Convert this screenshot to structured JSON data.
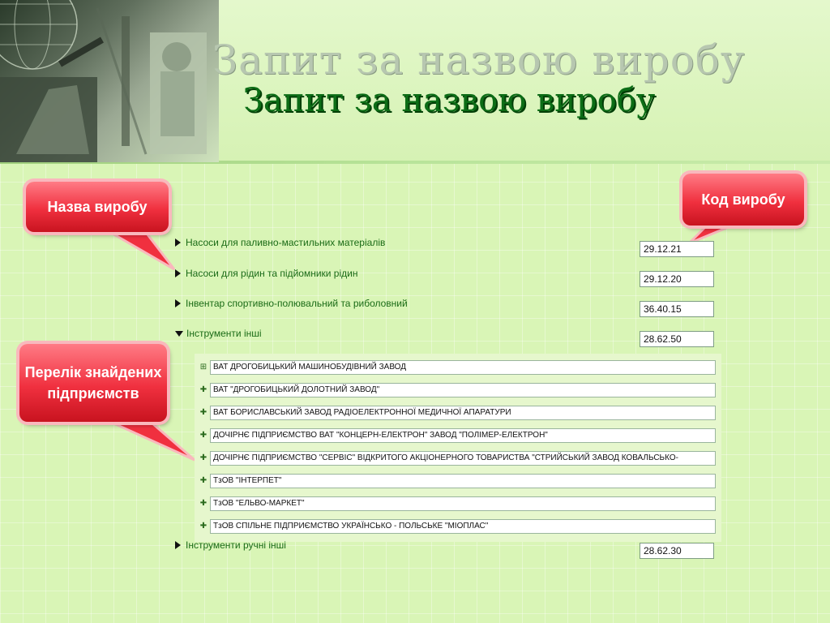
{
  "page": {
    "title": "Запит за назвою виробу"
  },
  "callouts": {
    "product_name": "Назва виробу",
    "product_code": "Код виробу",
    "enterprise_list": "Перелік знайдених підприємств"
  },
  "tree": [
    {
      "label": "Насоси для  паливно-мастильних  матеріалів",
      "code": "29.12.21",
      "expanded": false
    },
    {
      "label": "Насоси для рідин та підйомники рідин",
      "code": "29.12.20",
      "expanded": false
    },
    {
      "label": "Інвентар спортивно-полювальний та риболовний",
      "code": "36.40.15",
      "expanded": false
    },
    {
      "label": "Інструменти інші",
      "code": "28.62.50",
      "expanded": true
    },
    {
      "label": "Інструменти ручні інші",
      "code": "28.62.30",
      "expanded": false
    }
  ],
  "enterprises": [
    "ВАТ ДРОГОБИЦЬКИЙ МАШИНОБУДІВНИЙ ЗАВОД",
    "ВАТ \"ДРОГОБИЦЬКИЙ ДОЛОТНИЙ ЗАВОД\"",
    "ВАТ БОРИСЛАВСЬКИЙ ЗАВОД РАДІОЕЛЕКТРОННОЇ МЕДИЧНОЇ АПАРАТУРИ",
    "ДОЧІРНЄ ПІДПРИЄМСТВО ВАТ \"КОНЦЕРН-ЕЛЕКТРОН\" ЗАВОД \"ПОЛІМЕР-ЕЛЕКТРОН\"",
    "ДОЧІРНЄ ПІДПРИЄМСТВО \"СЕРВІС\" ВІДКРИТОГО АКЦІОНЕРНОГО ТОВАРИСТВА \"СТРИЙСЬКИЙ ЗАВОД КОВАЛЬСЬКО-",
    "ТзОВ \"ІНТЕРПЕТ\"",
    "ТзОВ \"ЕЛЬВО-МАРКЕТ\"",
    "ТзОВ СПІЛЬНЕ ПІДПРИЄМСТВО УКРАЇНСЬКО - ПОЛЬСЬКЕ \"МІОПЛАС\""
  ],
  "icons": {
    "collapsed_node": "triangle-right-icon",
    "expanded_node": "triangle-down-icon",
    "enterprise_expand": "plus-icon"
  },
  "colors": {
    "title_green": "#0c6d16",
    "callout_red": "#f0303f",
    "tree_text": "#1a6b16",
    "background": "#d9f5b6"
  }
}
